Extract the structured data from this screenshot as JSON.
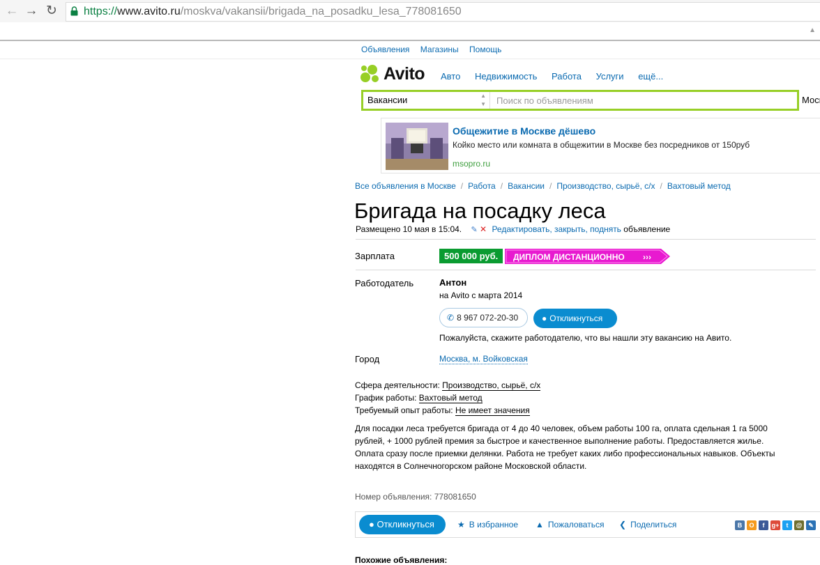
{
  "browser": {
    "url_scheme": "https://",
    "url_host": "www.avito.ru",
    "url_path": "/moskva/vakansii/brigada_na_posadku_lesa_778081650"
  },
  "top_links": [
    "Объявления",
    "Магазины",
    "Помощь"
  ],
  "logo": {
    "text": "Avito"
  },
  "main_nav": [
    "Авто",
    "Недвижимость",
    "Работа",
    "Услуги",
    "ещё..."
  ],
  "search": {
    "category": "Вакансии",
    "placeholder": "Поиск по объявлениям",
    "location": "Моск"
  },
  "ad": {
    "title": "Общежитие в Москве дёшево",
    "description": "Койко место или комната в общежитии в Москве без посредников от 150руб",
    "domain": "msopro.ru"
  },
  "breadcrumbs": [
    "Все объявления в Москве",
    "Работа",
    "Вакансии",
    "Производство, сырьё, с/х",
    "Вахтовый метод"
  ],
  "listing": {
    "title": "Бригада на посадку леса",
    "posted": "Размещено 10 мая в 15:04.",
    "edit_link": "Редактировать, закрыть, поднять",
    "edit_suffix": "объявление",
    "salary_label": "Зарплата",
    "salary": "500 000 руб.",
    "promo_text": "ДИПЛОМ ДИСТАНЦИОННО",
    "employer_label": "Работодатель",
    "employer_name": "Антон",
    "employer_since": "на Avito с марта 2014",
    "phone": "8 967 072-20-30",
    "reply_label": "Откликнуться",
    "employer_note": "Пожалуйста, скажите работодателю, что вы нашли эту вакансию на Авито.",
    "city_label": "Город",
    "city": "Москва, м. Войковская",
    "attributes": [
      {
        "label": "Сфера деятельности:",
        "value": "Производство, сырьё, с/х"
      },
      {
        "label": "График работы:",
        "value": "Вахтовый метод"
      },
      {
        "label": "Требуемый опыт работы:",
        "value": "Не имеет значения"
      }
    ],
    "description_lines": [
      "Для посадки леса требуется бригада от 4 до 40 человек, объем работы 100 га, оплата сдельная 1 га 5000",
      "рублей, + 1000 рублей премия за быстрое и качественное выполнение работы. Предоставляется жилье.",
      "Оплата сразу после приемки делянки. Работа не требует каких либо профессиональных навыков. Объекты",
      "находятся в Солнечногорском районе Московской области."
    ],
    "ad_number": "Номер объявления: 778081650"
  },
  "actions": {
    "reply": "Откликнуться",
    "favorite": "В избранное",
    "complain": "Пожаловаться",
    "share": "Поделиться"
  },
  "social": [
    {
      "name": "vk",
      "label": "В",
      "color": "#4a76a8"
    },
    {
      "name": "odnoklassniki",
      "label": "О",
      "color": "#f59a1e"
    },
    {
      "name": "facebook",
      "label": "f",
      "color": "#3b5998"
    },
    {
      "name": "google-plus",
      "label": "g+",
      "color": "#dd4b39"
    },
    {
      "name": "twitter",
      "label": "t",
      "color": "#1da1f2"
    },
    {
      "name": "mailru",
      "label": "@",
      "color": "#6e6e2f"
    },
    {
      "name": "livejournal",
      "label": "✎",
      "color": "#2b72b5"
    }
  ],
  "similar_heading": "Похожие объявления:",
  "colors": {
    "brand_green": "#97cf26",
    "link_blue": "#0a6ab0",
    "button_blue": "#0a8cd0",
    "price_green": "#0a9b31",
    "promo_magenta": "#e81ad0"
  }
}
